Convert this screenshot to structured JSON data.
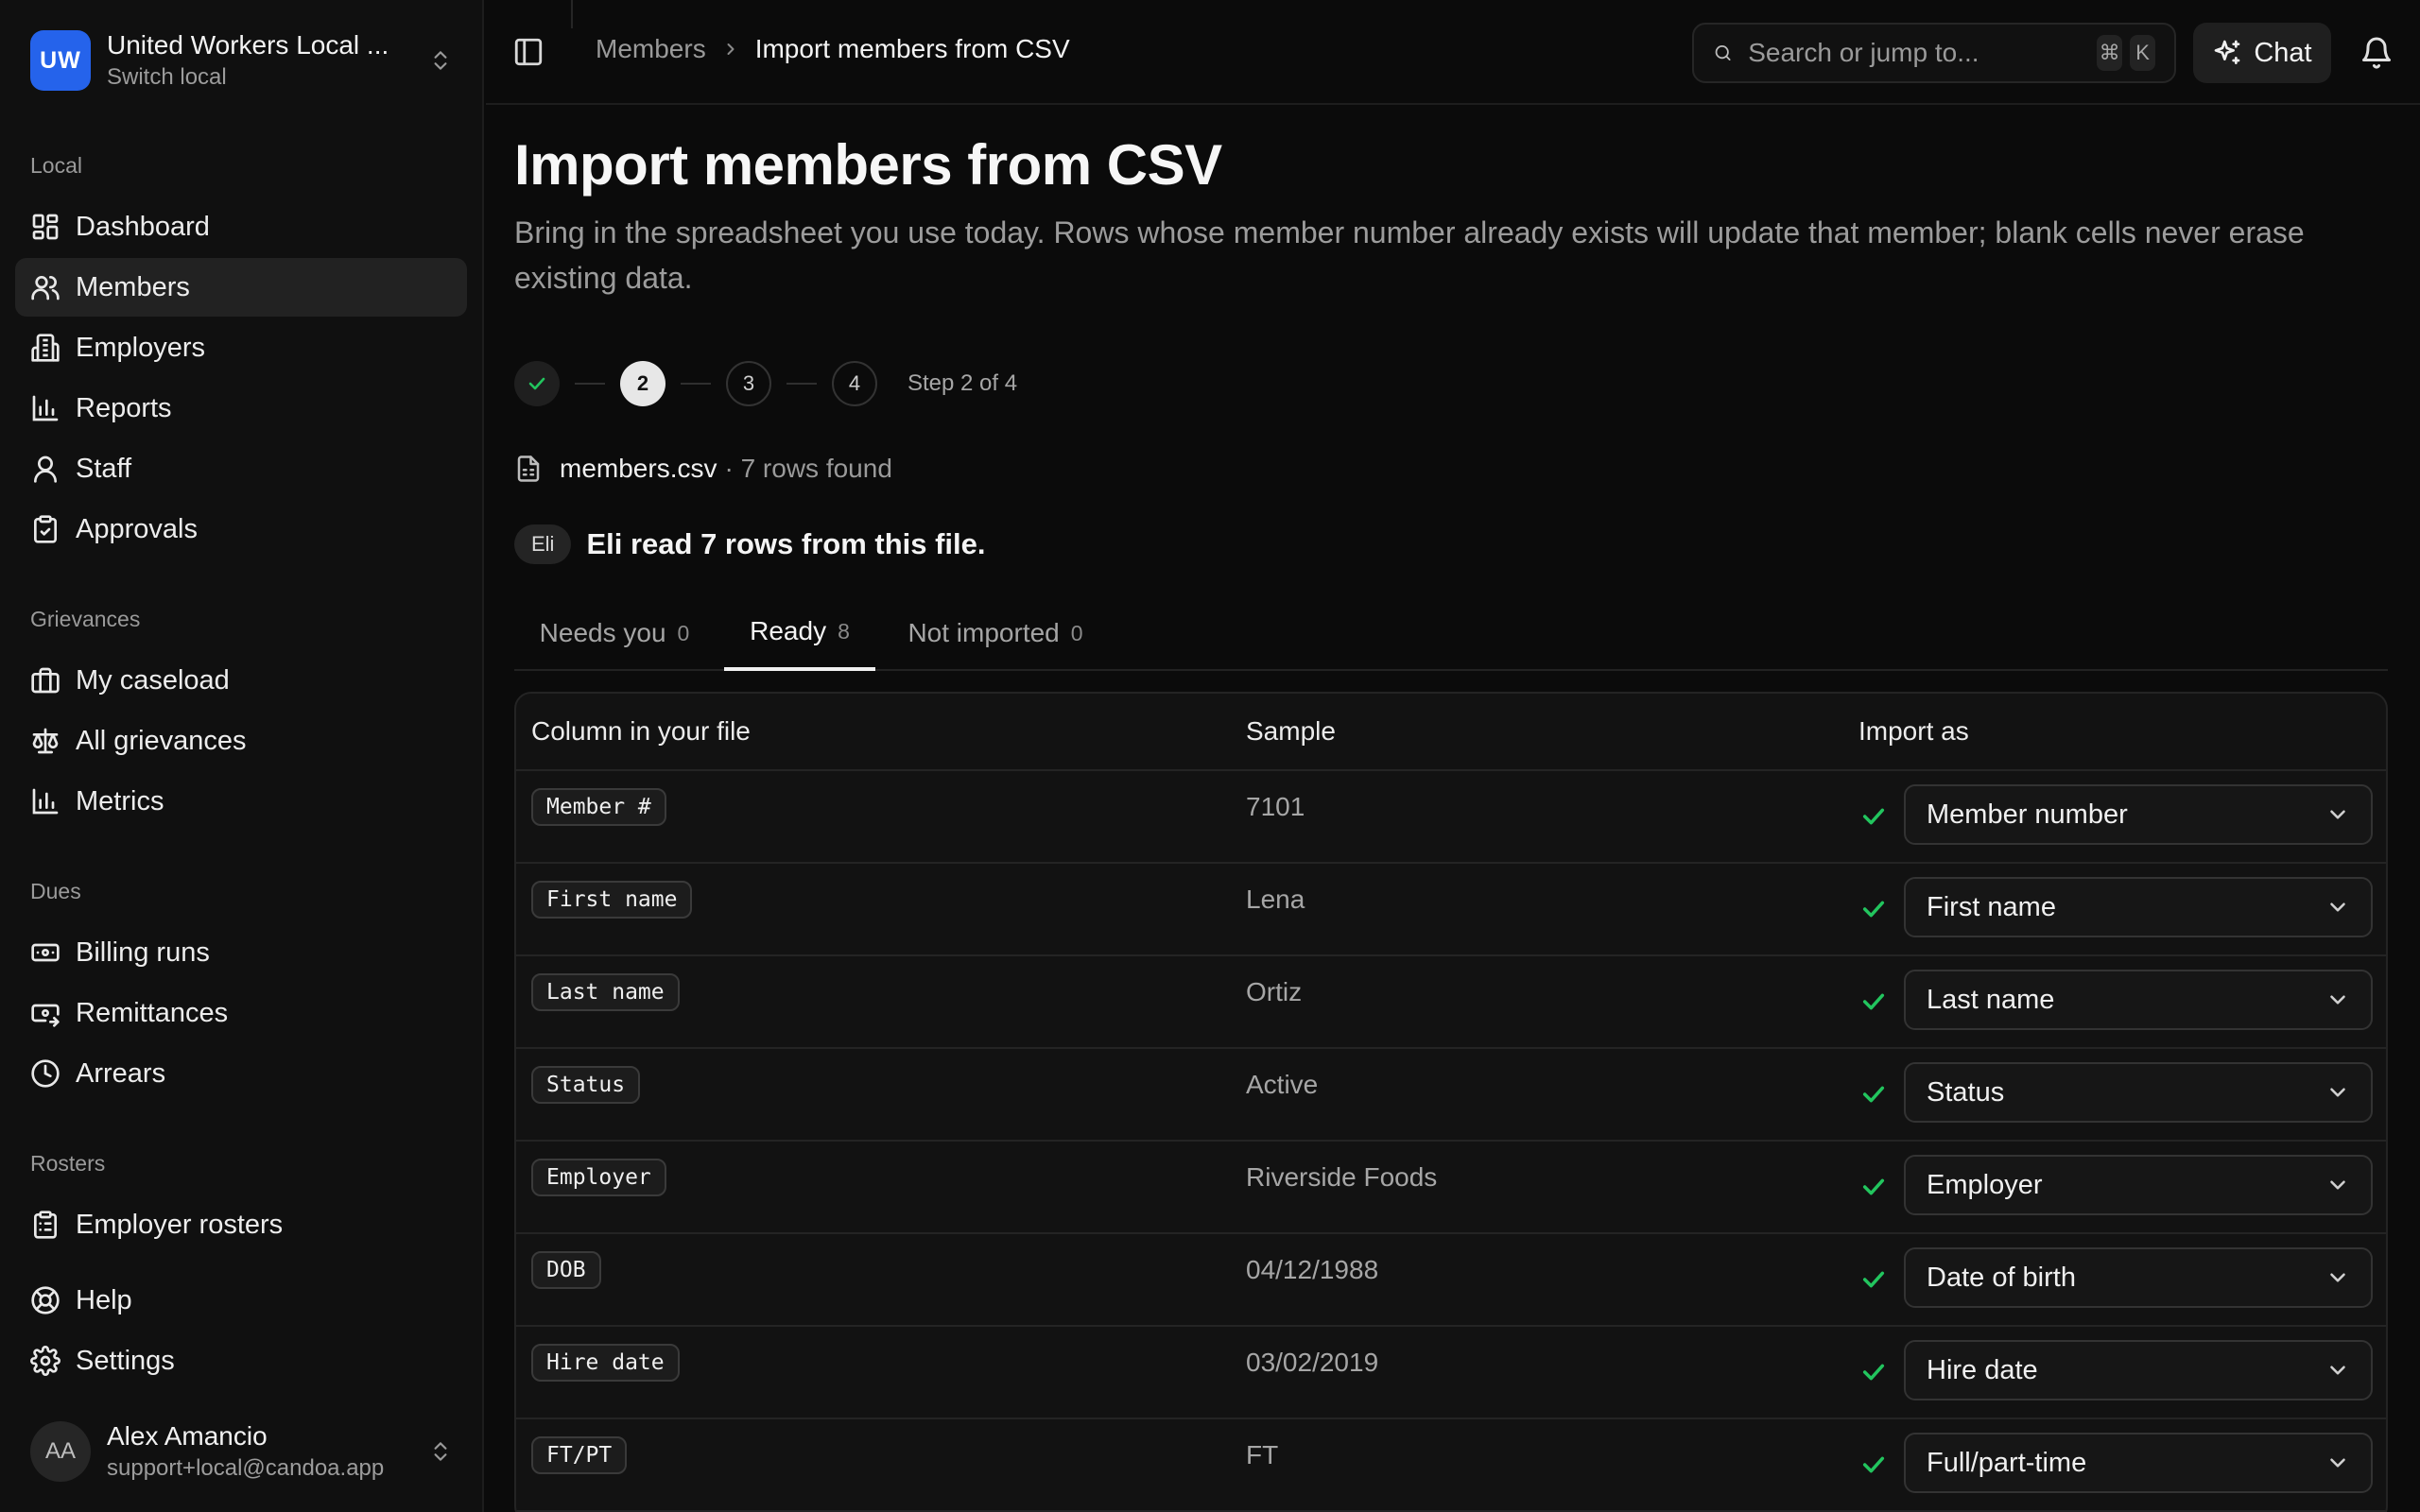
{
  "org": {
    "initials": "UW",
    "name": "United Workers Local ...",
    "subtitle": "Switch local"
  },
  "sidebar": {
    "sections": [
      {
        "label": "Local"
      },
      {
        "label": "Grievances"
      },
      {
        "label": "Dues"
      },
      {
        "label": "Rosters"
      }
    ],
    "items": [
      {
        "label": "Dashboard",
        "icon": "dashboard-icon"
      },
      {
        "label": "Members",
        "icon": "users-icon",
        "active": true
      },
      {
        "label": "Employers",
        "icon": "building-icon"
      },
      {
        "label": "Reports",
        "icon": "bar-chart-icon"
      },
      {
        "label": "Staff",
        "icon": "user-icon"
      },
      {
        "label": "Approvals",
        "icon": "clipboard-check-icon"
      },
      {
        "label": "My caseload",
        "icon": "briefcase-icon"
      },
      {
        "label": "All grievances",
        "icon": "scale-icon"
      },
      {
        "label": "Metrics",
        "icon": "bar-chart-icon"
      },
      {
        "label": "Billing runs",
        "icon": "banknote-icon"
      },
      {
        "label": "Remittances",
        "icon": "banknote-arrow-icon"
      },
      {
        "label": "Arrears",
        "icon": "clock-icon"
      },
      {
        "label": "Employer rosters",
        "icon": "clipboard-list-icon"
      },
      {
        "label": "Help",
        "icon": "life-buoy-icon"
      },
      {
        "label": "Settings",
        "icon": "gear-icon"
      }
    ]
  },
  "user": {
    "initials": "AA",
    "name": "Alex Amancio",
    "email": "support+local@candoa.app"
  },
  "topbar": {
    "breadcrumb": {
      "parent": "Members",
      "current": "Import members from CSV"
    },
    "search_placeholder": "Search or jump to...",
    "kbd": [
      "⌘",
      "K"
    ],
    "chat_label": "Chat"
  },
  "page": {
    "title": "Import members from CSV",
    "description": "Bring in the spreadsheet you use today. Rows whose member number already exists will update that member; blank cells never erase existing data."
  },
  "stepper": {
    "steps": [
      "✓",
      "2",
      "3",
      "4"
    ],
    "current": 2,
    "label": "Step 2 of 4"
  },
  "file": {
    "name": "members.csv",
    "info": "· 7 rows found"
  },
  "assistant": {
    "badge": "Eli",
    "message": "Eli read 7 rows from this file."
  },
  "tabs": [
    {
      "label": "Needs you",
      "count": "0"
    },
    {
      "label": "Ready",
      "count": "8",
      "active": true
    },
    {
      "label": "Not imported",
      "count": "0"
    }
  ],
  "table": {
    "headers": [
      "Column in your file",
      "Sample",
      "Import as"
    ],
    "rows": [
      {
        "column": "Member #",
        "sample": "7101",
        "import_as": "Member number"
      },
      {
        "column": "First name",
        "sample": "Lena",
        "import_as": "First name"
      },
      {
        "column": "Last name",
        "sample": "Ortiz",
        "import_as": "Last name"
      },
      {
        "column": "Status",
        "sample": "Active",
        "import_as": "Status"
      },
      {
        "column": "Employer",
        "sample": "Riverside Foods",
        "import_as": "Employer"
      },
      {
        "column": "DOB",
        "sample": "04/12/1988",
        "import_as": "Date of birth"
      },
      {
        "column": "Hire date",
        "sample": "03/02/2019",
        "import_as": "Hire date"
      },
      {
        "column": "FT/PT",
        "sample": "FT",
        "import_as": "Full/part-time"
      }
    ]
  },
  "colors": {
    "accent": "#2563eb",
    "check": "#22c55e",
    "background": "#0b0b0b"
  }
}
